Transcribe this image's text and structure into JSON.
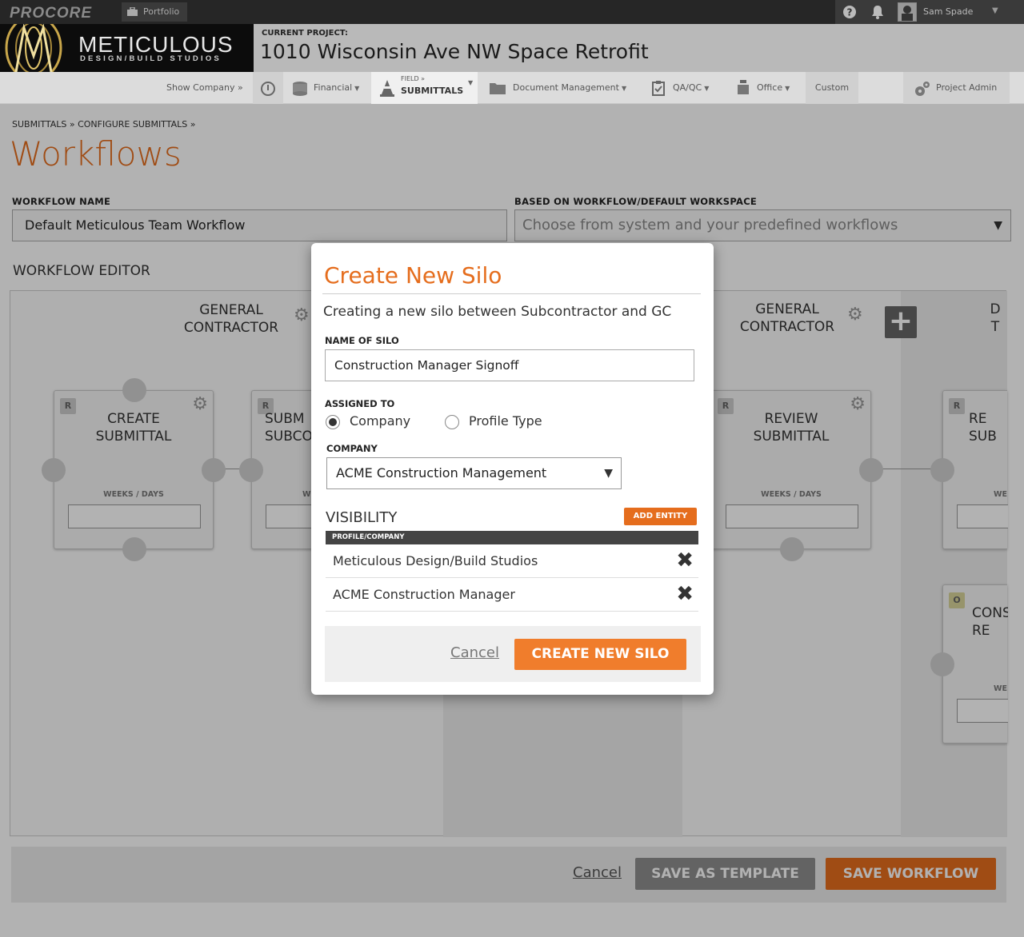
{
  "topbar": {
    "logo": "PROCORE",
    "portfolio": "Portfolio",
    "user_name": "Sam Spade"
  },
  "brand": {
    "main": "METICULOUS",
    "sub": "DESIGN/BUILD STUDIOS"
  },
  "project": {
    "label": "CURRENT PROJECT:",
    "name": "1010 Wisconsin Ave NW Space Retrofit"
  },
  "nav": {
    "show_company": "Show Company »",
    "financial": "Financial",
    "field_small": "FIELD »",
    "field_big": "SUBMITTALS",
    "document": "Document Management",
    "qaqc": "QA/QC",
    "office": "Office",
    "custom": "Custom",
    "project_admin": "Project Admin"
  },
  "page": {
    "breadcrumb": "SUBMITTALS » CONFIGURE SUBMITTALS »",
    "title": "Workflows",
    "wf_name_label": "WORKFLOW NAME",
    "wf_name_value": "Default Meticulous Team Workflow",
    "based_label": "BASED ON WORKFLOW/DEFAULT WORKSPACE",
    "based_placeholder": "Choose from system and your predefined workflows",
    "editor_title": "WORKFLOW EDITOR"
  },
  "editor": {
    "col1_head": "GENERAL CONTRACTOR",
    "col2_head": "GENERAL CONTRACTOR",
    "col3_head_fragment": "D T",
    "cards": [
      {
        "badge": "R",
        "title": "CREATE SUBMITTAL",
        "wd": "WEEKS / DAYS"
      },
      {
        "badge": "R",
        "title": "SUBM SUBCO",
        "wd": "W"
      },
      {
        "badge": "R",
        "title": "REVIEW SUBMITTAL",
        "wd": "WEEKS / DAYS"
      },
      {
        "badge": "R",
        "title": "RE SUB",
        "wd": "WE"
      },
      {
        "badge": "O",
        "title": "CONS RE",
        "wd": "WE"
      }
    ]
  },
  "footer": {
    "cancel": "Cancel",
    "save_template": "SAVE AS TEMPLATE",
    "save_workflow": "SAVE WORKFLOW"
  },
  "modal": {
    "title": "Create New Silo",
    "desc": "Creating a new silo between Subcontractor and GC",
    "name_label": "NAME OF SILO",
    "name_value": "Construction Manager Signoff",
    "assigned_label": "ASSIGNED TO",
    "opt_company": "Company",
    "opt_profile": "Profile Type",
    "company_label": "COMPANY",
    "company_value": "ACME Construction Management",
    "visibility_title": "VISIBILITY",
    "add_entity": "ADD ENTITY",
    "vis_header": "PROFILE/COMPANY",
    "vis_rows": [
      "Meticulous Design/Build Studios",
      "ACME Construction Manager"
    ],
    "cancel": "Cancel",
    "create": "CREATE NEW SILO"
  },
  "colors": {
    "accent": "#e56d1d",
    "dark": "#262626"
  }
}
